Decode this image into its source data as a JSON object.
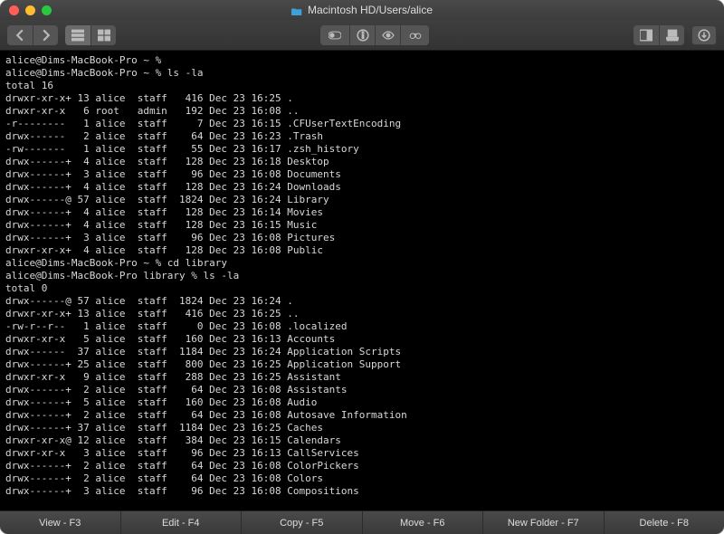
{
  "window": {
    "title": "Macintosh HD/Users/alice"
  },
  "toolbar": {
    "icons": [
      "back",
      "forward",
      "icon-view",
      "list-view",
      "toggle",
      "info",
      "preview",
      "binoculars",
      "panel",
      "stack",
      "download"
    ]
  },
  "prompts": {
    "p1": "alice@Dims-MacBook-Pro ~ %",
    "p2": "alice@Dims-MacBook-Pro ~ % ls -la",
    "p3": "alice@Dims-MacBook-Pro ~ % cd library",
    "p4": "alice@Dims-MacBook-Pro library % ls -la"
  },
  "listing1": {
    "total": "total 16",
    "rows": [
      {
        "perm": "drwxr-xr-x+",
        "links": "13",
        "owner": "alice",
        "group": "staff",
        "size": "416",
        "date": "Dec 23 16:25",
        "name": "."
      },
      {
        "perm": "drwxr-xr-x",
        "links": "6",
        "owner": "root",
        "group": "admin",
        "size": "192",
        "date": "Dec 23 16:08",
        "name": ".."
      },
      {
        "perm": "-r--------",
        "links": "1",
        "owner": "alice",
        "group": "staff",
        "size": "7",
        "date": "Dec 23 16:15",
        "name": ".CFUserTextEncoding"
      },
      {
        "perm": "drwx------",
        "links": "2",
        "owner": "alice",
        "group": "staff",
        "size": "64",
        "date": "Dec 23 16:23",
        "name": ".Trash"
      },
      {
        "perm": "-rw-------",
        "links": "1",
        "owner": "alice",
        "group": "staff",
        "size": "55",
        "date": "Dec 23 16:17",
        "name": ".zsh_history"
      },
      {
        "perm": "drwx------+",
        "links": "4",
        "owner": "alice",
        "group": "staff",
        "size": "128",
        "date": "Dec 23 16:18",
        "name": "Desktop"
      },
      {
        "perm": "drwx------+",
        "links": "3",
        "owner": "alice",
        "group": "staff",
        "size": "96",
        "date": "Dec 23 16:08",
        "name": "Documents"
      },
      {
        "perm": "drwx------+",
        "links": "4",
        "owner": "alice",
        "group": "staff",
        "size": "128",
        "date": "Dec 23 16:24",
        "name": "Downloads"
      },
      {
        "perm": "drwx------@",
        "links": "57",
        "owner": "alice",
        "group": "staff",
        "size": "1824",
        "date": "Dec 23 16:24",
        "name": "Library"
      },
      {
        "perm": "drwx------+",
        "links": "4",
        "owner": "alice",
        "group": "staff",
        "size": "128",
        "date": "Dec 23 16:14",
        "name": "Movies"
      },
      {
        "perm": "drwx------+",
        "links": "4",
        "owner": "alice",
        "group": "staff",
        "size": "128",
        "date": "Dec 23 16:15",
        "name": "Music"
      },
      {
        "perm": "drwx------+",
        "links": "3",
        "owner": "alice",
        "group": "staff",
        "size": "96",
        "date": "Dec 23 16:08",
        "name": "Pictures"
      },
      {
        "perm": "drwxr-xr-x+",
        "links": "4",
        "owner": "alice",
        "group": "staff",
        "size": "128",
        "date": "Dec 23 16:08",
        "name": "Public"
      }
    ]
  },
  "listing2": {
    "total": "total 0",
    "rows": [
      {
        "perm": "drwx------@",
        "links": "57",
        "owner": "alice",
        "group": "staff",
        "size": "1824",
        "date": "Dec 23 16:24",
        "name": "."
      },
      {
        "perm": "drwxr-xr-x+",
        "links": "13",
        "owner": "alice",
        "group": "staff",
        "size": "416",
        "date": "Dec 23 16:25",
        "name": ".."
      },
      {
        "perm": "-rw-r--r--",
        "links": "1",
        "owner": "alice",
        "group": "staff",
        "size": "0",
        "date": "Dec 23 16:08",
        "name": ".localized"
      },
      {
        "perm": "drwxr-xr-x",
        "links": "5",
        "owner": "alice",
        "group": "staff",
        "size": "160",
        "date": "Dec 23 16:13",
        "name": "Accounts"
      },
      {
        "perm": "drwx------",
        "links": "37",
        "owner": "alice",
        "group": "staff",
        "size": "1184",
        "date": "Dec 23 16:24",
        "name": "Application Scripts"
      },
      {
        "perm": "drwx------+",
        "links": "25",
        "owner": "alice",
        "group": "staff",
        "size": "800",
        "date": "Dec 23 16:25",
        "name": "Application Support"
      },
      {
        "perm": "drwxr-xr-x",
        "links": "9",
        "owner": "alice",
        "group": "staff",
        "size": "288",
        "date": "Dec 23 16:25",
        "name": "Assistant"
      },
      {
        "perm": "drwx------+",
        "links": "2",
        "owner": "alice",
        "group": "staff",
        "size": "64",
        "date": "Dec 23 16:08",
        "name": "Assistants"
      },
      {
        "perm": "drwx------+",
        "links": "5",
        "owner": "alice",
        "group": "staff",
        "size": "160",
        "date": "Dec 23 16:08",
        "name": "Audio"
      },
      {
        "perm": "drwx------+",
        "links": "2",
        "owner": "alice",
        "group": "staff",
        "size": "64",
        "date": "Dec 23 16:08",
        "name": "Autosave Information"
      },
      {
        "perm": "drwx------+",
        "links": "37",
        "owner": "alice",
        "group": "staff",
        "size": "1184",
        "date": "Dec 23 16:25",
        "name": "Caches"
      },
      {
        "perm": "drwxr-xr-x@",
        "links": "12",
        "owner": "alice",
        "group": "staff",
        "size": "384",
        "date": "Dec 23 16:15",
        "name": "Calendars"
      },
      {
        "perm": "drwxr-xr-x",
        "links": "3",
        "owner": "alice",
        "group": "staff",
        "size": "96",
        "date": "Dec 23 16:13",
        "name": "CallServices"
      },
      {
        "perm": "drwx------+",
        "links": "2",
        "owner": "alice",
        "group": "staff",
        "size": "64",
        "date": "Dec 23 16:08",
        "name": "ColorPickers"
      },
      {
        "perm": "drwx------+",
        "links": "2",
        "owner": "alice",
        "group": "staff",
        "size": "64",
        "date": "Dec 23 16:08",
        "name": "Colors"
      },
      {
        "perm": "drwx------+",
        "links": "3",
        "owner": "alice",
        "group": "staff",
        "size": "96",
        "date": "Dec 23 16:08",
        "name": "Compositions"
      }
    ]
  },
  "bottom": {
    "buttons": [
      "View - F3",
      "Edit - F4",
      "Copy - F5",
      "Move - F6",
      "New Folder - F7",
      "Delete - F8"
    ]
  }
}
